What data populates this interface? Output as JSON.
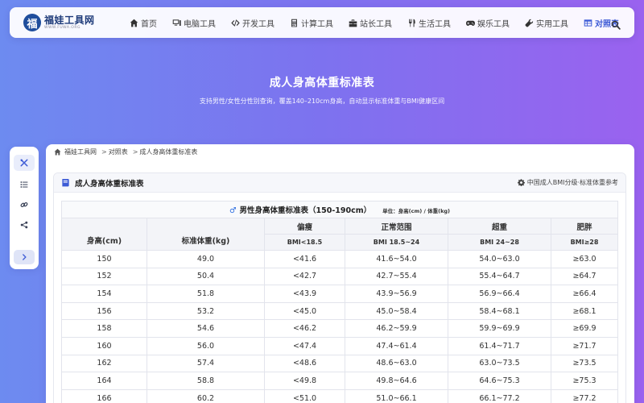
{
  "nav": {
    "logo_mark": "福",
    "logo_title": "福娃工具网",
    "logo_sub": "WWW.FUWA.ORG",
    "items": [
      {
        "label": "首页",
        "icon": "home-icon"
      },
      {
        "label": "电脑工具",
        "icon": "computer-icon"
      },
      {
        "label": "开发工具",
        "icon": "code-icon"
      },
      {
        "label": "计算工具",
        "icon": "calculator-icon"
      },
      {
        "label": "站长工具",
        "icon": "toolbox-icon"
      },
      {
        "label": "生活工具",
        "icon": "utensils-icon"
      },
      {
        "label": "娱乐工具",
        "icon": "gamepad-icon"
      },
      {
        "label": "实用工具",
        "icon": "wrench-icon"
      },
      {
        "label": "对照表",
        "icon": "table-icon",
        "active": true
      }
    ],
    "search_icon": "search-icon",
    "accent_color": "#3d5bd6"
  },
  "hero": {
    "title": "成人身高体重标准表",
    "subtitle": "支持男性/女性分性别查询，覆盖140–210cm身高，自动显示标准体重与BMI健康区间"
  },
  "dock": {
    "buttons": [
      "tools-icon",
      "list-icon",
      "link-icon",
      "share-icon",
      "chevron-right-icon"
    ]
  },
  "breadcrumb": {
    "home": "福娃工具网",
    "level1": "对照表",
    "level2": "成人身高体重标准表",
    "separator": ">"
  },
  "card": {
    "title": "成人身高体重标准表",
    "reference": "中国成人BMI分级·标准体重参考"
  },
  "table": {
    "caption": "男性身高体重标准表（150-190cm）",
    "caption_symbol": "♂",
    "unit_note": "单位：身高(cm) / 体重(kg)",
    "headers": {
      "height": "身高(cm)",
      "standard_weight": "标准体重(kg)",
      "underweight": "偏瘦",
      "normal": "正常范围",
      "overweight": "超重",
      "obese": "肥胖"
    },
    "bmi_headers": {
      "underweight": "BMI<18.5",
      "normal": "BMI 18.5~24",
      "overweight": "BMI 24~28",
      "obese": "BMI≥28"
    },
    "rows": [
      [
        "150",
        "49.0",
        "<41.6",
        "41.6~54.0",
        "54.0~63.0",
        "≥63.0"
      ],
      [
        "152",
        "50.4",
        "<42.7",
        "42.7~55.4",
        "55.4~64.7",
        "≥64.7"
      ],
      [
        "154",
        "51.8",
        "<43.9",
        "43.9~56.9",
        "56.9~66.4",
        "≥66.4"
      ],
      [
        "156",
        "53.2",
        "<45.0",
        "45.0~58.4",
        "58.4~68.1",
        "≥68.1"
      ],
      [
        "158",
        "54.6",
        "<46.2",
        "46.2~59.9",
        "59.9~69.9",
        "≥69.9"
      ],
      [
        "160",
        "56.0",
        "<47.4",
        "47.4~61.4",
        "61.4~71.7",
        "≥71.7"
      ],
      [
        "162",
        "57.4",
        "<48.6",
        "48.6~63.0",
        "63.0~73.5",
        "≥73.5"
      ],
      [
        "164",
        "58.8",
        "<49.8",
        "49.8~64.6",
        "64.6~75.3",
        "≥75.3"
      ],
      [
        "166",
        "60.2",
        "<51.0",
        "51.0~66.1",
        "66.1~77.2",
        "≥77.2"
      ]
    ]
  }
}
